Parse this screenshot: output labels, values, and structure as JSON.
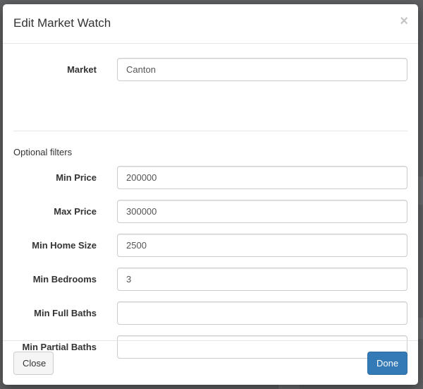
{
  "modal": {
    "title": "Edit Market Watch",
    "close_icon": "×"
  },
  "form": {
    "market": {
      "label": "Market",
      "value": "Canton"
    },
    "section_label": "Optional filters",
    "min_price": {
      "label": "Min Price",
      "value": "200000"
    },
    "max_price": {
      "label": "Max Price",
      "value": "300000"
    },
    "min_home_size": {
      "label": "Min Home Size",
      "value": "2500"
    },
    "min_bedrooms": {
      "label": "Min Bedrooms",
      "value": "3"
    },
    "min_full_baths": {
      "label": "Min Full Baths",
      "value": ""
    },
    "min_partial_baths": {
      "label": "Min Partial Baths",
      "value": ""
    }
  },
  "footer": {
    "close_label": "Close",
    "done_label": "Done"
  },
  "colors": {
    "primary": "#337ab7",
    "backdrop": "#5f6163"
  }
}
